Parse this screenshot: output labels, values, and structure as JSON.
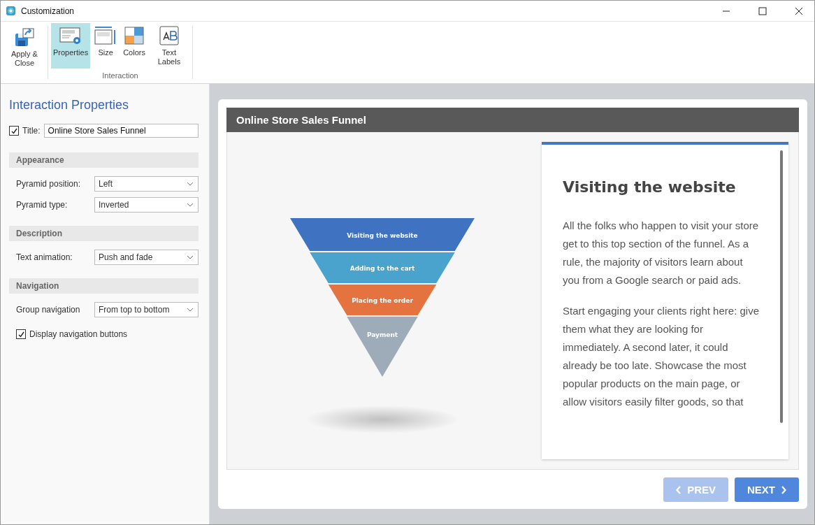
{
  "window": {
    "title": "Customization"
  },
  "ribbon": {
    "items": [
      {
        "label": "Apply & Close",
        "kind": "apply",
        "selected": false
      },
      {
        "label": "Properties",
        "kind": "properties",
        "selected": true
      },
      {
        "label": "Size",
        "kind": "size",
        "selected": false
      },
      {
        "label": "Colors",
        "kind": "colors",
        "selected": false
      },
      {
        "label": "Text Labels",
        "kind": "labels",
        "selected": false
      }
    ],
    "group_label": "Interaction"
  },
  "panel": {
    "heading": "Interaction Properties",
    "title_checkbox": {
      "label": "Title:",
      "checked": true
    },
    "title_value": "Online Store Sales Funnel",
    "sections": [
      {
        "heading": "Appearance",
        "fields": [
          {
            "label": "Pyramid position:",
            "value": "Left"
          },
          {
            "label": "Pyramid type:",
            "value": "Inverted"
          }
        ]
      },
      {
        "heading": "Description",
        "fields": [
          {
            "label": "Text animation:",
            "value": "Push and fade"
          }
        ]
      },
      {
        "heading": "Navigation",
        "fields": [
          {
            "label": "Group navigation",
            "value": "From top to bottom"
          }
        ]
      }
    ],
    "nav_checkbox": {
      "label": "Display navigation buttons",
      "checked": true
    }
  },
  "preview": {
    "title": "Online Store Sales Funnel",
    "funnel": [
      {
        "label": "Visiting the website",
        "color": "#3f72c0"
      },
      {
        "label": "Adding to the cart",
        "color": "#49a3cc"
      },
      {
        "label": "Placing the order",
        "color": "#e5733f"
      },
      {
        "label": "Payment",
        "color": "#9eabb9"
      }
    ],
    "detail": {
      "heading": "Visiting the website",
      "paragraphs": [
        "All the folks who happen to visit your store get to this top section of the funnel. As a rule, the majority of visitors learn about you from a Google search or paid ads.",
        "Start engaging your clients right here: give them what they are looking for immediately. A second later, it could already be too late. Showcase the most popular products on the main page, or allow visitors easily filter goods, so that"
      ]
    },
    "buttons": [
      {
        "label": "PREV",
        "kind": "prev",
        "disabled": true
      },
      {
        "label": "NEXT",
        "kind": "next",
        "disabled": false
      }
    ]
  }
}
